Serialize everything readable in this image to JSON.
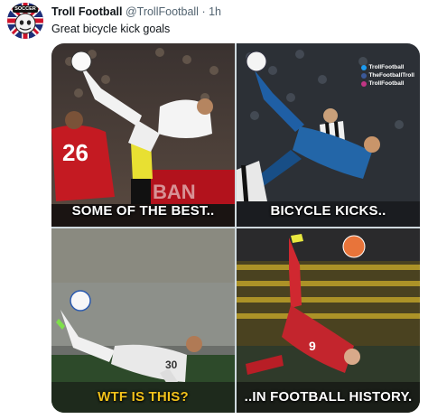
{
  "tweet": {
    "display_name": "Troll Football",
    "handle": "@TrollFootball",
    "separator": "·",
    "time": "1h",
    "text": "Great bicycle kick goals",
    "avatar_badge": "SOCCER"
  },
  "media": {
    "panels": [
      {
        "caption": "SOME OF THE BEST..",
        "caption_color": "#ffffff",
        "jersey_number": "26",
        "ad_board": "BAN"
      },
      {
        "caption": "BICYCLE KICKS..",
        "caption_color": "#ffffff",
        "watermark": [
          "TrollFootball",
          "TheFootballTroll",
          "TrollFootball"
        ]
      },
      {
        "caption": "WTF IS THIS?",
        "caption_color": "#f2c21b",
        "jersey_number": "30"
      },
      {
        "caption": "..IN FOOTBALL HISTORY.",
        "caption_color": "#ffffff",
        "jersey_number": "9"
      }
    ]
  }
}
